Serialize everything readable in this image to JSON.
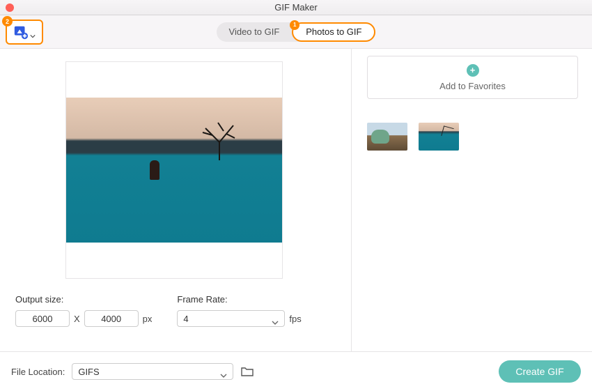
{
  "window": {
    "title": "GIF Maker"
  },
  "toolbar": {
    "upload_badge": "2",
    "mode_video_label": "Video to GIF",
    "mode_photos_label": "Photos to GIF",
    "photos_badge": "1"
  },
  "controls": {
    "output_size_label": "Output size:",
    "width_value": "6000",
    "height_value": "4000",
    "separator": "X",
    "size_unit": "px",
    "frame_rate_label": "Frame Rate:",
    "fps_value": "4",
    "fps_unit": "fps"
  },
  "favorites": {
    "label": "Add to Favorites"
  },
  "thumbnails": [
    {
      "name": "car-landscape"
    },
    {
      "name": "water-tree"
    }
  ],
  "bottom": {
    "file_location_label": "File Location:",
    "location_value": "GIFS",
    "create_label": "Create GIF"
  },
  "colors": {
    "accent_orange": "#ff8a00",
    "accent_teal": "#5ec0b6"
  }
}
